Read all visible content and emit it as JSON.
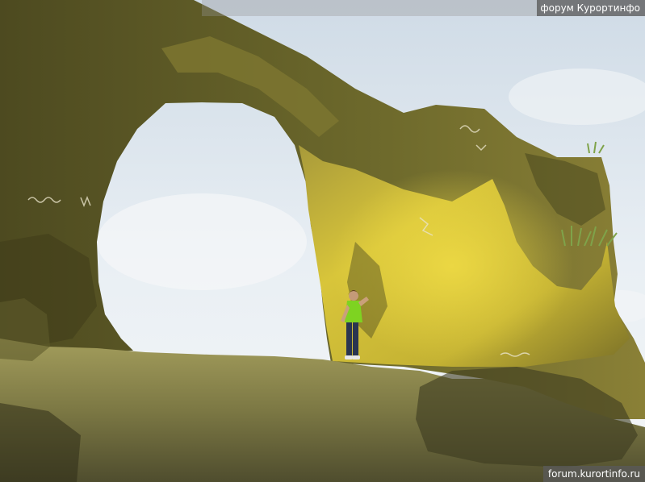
{
  "watermark": {
    "top_text": "форум Курортинфо",
    "bottom_text": "forum.kurortinfo.ru"
  },
  "colors": {
    "sky": "#e6eef4",
    "rock_shadow": "#5e5a26",
    "rock_lit": "#d9c437",
    "ground": "#8a8448",
    "shirt": "#7ed321",
    "jeans": "#2a3550"
  }
}
